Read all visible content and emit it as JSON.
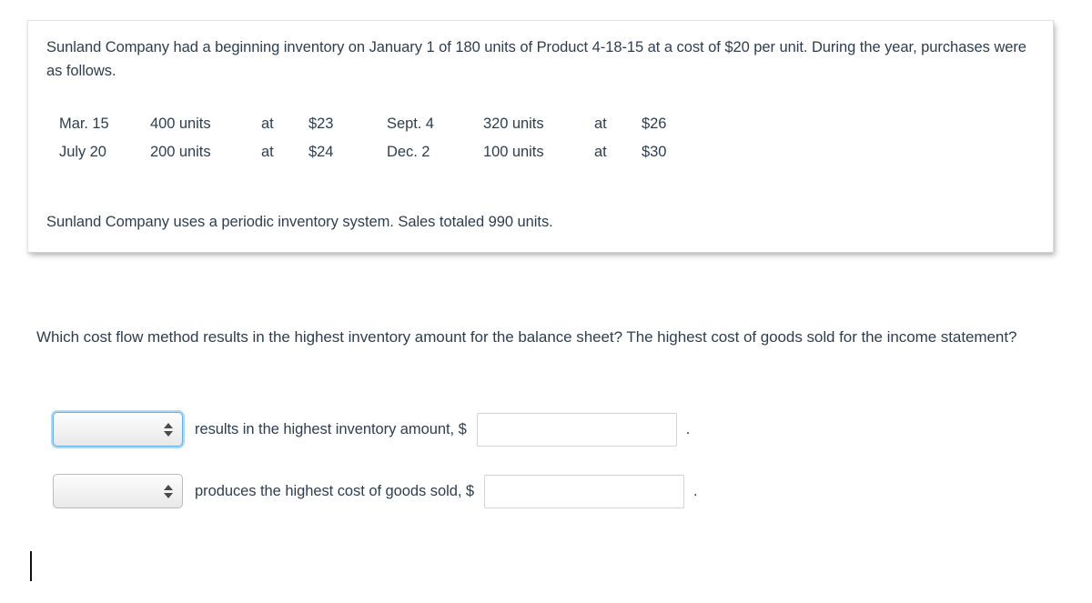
{
  "problem": {
    "intro": "Sunland Company had a beginning inventory on January 1 of 180 units of Product 4-18-15 at a cost of $20 per unit. During the year, purchases were as follows.",
    "purchases_table": {
      "rows": [
        {
          "date_left": "Mar. 15",
          "units_left": "400 units",
          "at_left": "at",
          "price_left": "$23",
          "date_right": "Sept. 4",
          "units_right": "320 units",
          "at_right": "at",
          "price_right": "$26"
        },
        {
          "date_left": "July 20",
          "units_left": "200 units",
          "at_left": "at",
          "price_left": "$24",
          "date_right": "Dec. 2",
          "units_right": "100 units",
          "at_right": "at",
          "price_right": "$30"
        }
      ]
    },
    "system_note": "Sunland Company uses a periodic inventory system. Sales totaled 990 units."
  },
  "question": "Which cost flow method results in the highest inventory amount for the balance sheet? The highest cost of goods sold for the income statement?",
  "answers": {
    "rows": [
      {
        "select_value": "",
        "select_placeholder": "",
        "label": "results in the highest inventory amount, $",
        "input_value": "",
        "input_placeholder": "",
        "trailing_punctuation": "."
      },
      {
        "select_value": "",
        "select_placeholder": "",
        "label": "produces the highest cost of goods sold, $",
        "input_value": "",
        "input_placeholder": "",
        "trailing_punctuation": "."
      }
    ]
  },
  "colors": {
    "text": "#2f3e4f",
    "focus_ring": "#64aee0",
    "card_border": "#e2e4e6",
    "input_border": "#d3d5d7"
  }
}
